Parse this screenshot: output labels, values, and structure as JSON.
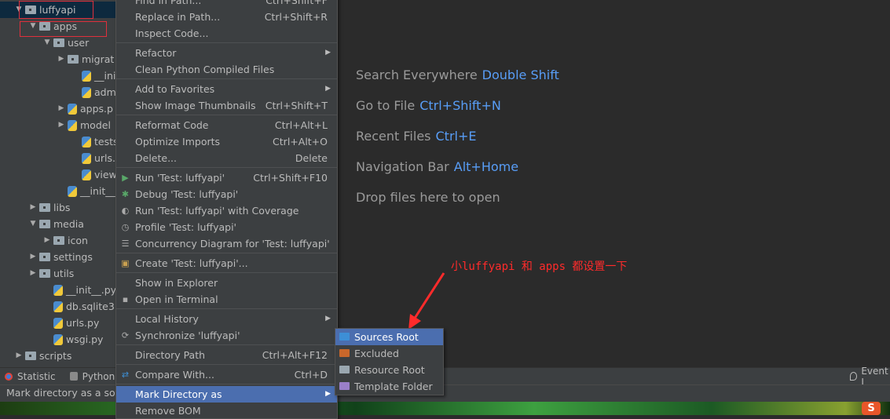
{
  "project_tree": [
    {
      "label": "luffyapi",
      "type": "folder",
      "indent": 0,
      "arrow": "down",
      "selected": true
    },
    {
      "label": "apps",
      "type": "folder",
      "indent": 1,
      "arrow": "down"
    },
    {
      "label": "user",
      "type": "folder",
      "indent": 2,
      "arrow": "down"
    },
    {
      "label": "migrat",
      "type": "folder",
      "indent": 3,
      "arrow": "right"
    },
    {
      "label": "__init__",
      "type": "py",
      "indent": 4
    },
    {
      "label": "admin",
      "type": "py",
      "indent": 4
    },
    {
      "label": "apps.p",
      "type": "py",
      "indent": 3,
      "arrow": "right"
    },
    {
      "label": "model",
      "type": "py",
      "indent": 3,
      "arrow": "right"
    },
    {
      "label": "tests.p",
      "type": "py",
      "indent": 4
    },
    {
      "label": "urls.py",
      "type": "py",
      "indent": 4
    },
    {
      "label": "views.p",
      "type": "py",
      "indent": 4
    },
    {
      "label": "__init__.py",
      "type": "py",
      "indent": 3
    },
    {
      "label": "libs",
      "type": "folder",
      "indent": 1,
      "arrow": "right"
    },
    {
      "label": "media",
      "type": "folder",
      "indent": 1,
      "arrow": "down"
    },
    {
      "label": "icon",
      "type": "folder",
      "indent": 2,
      "arrow": "right"
    },
    {
      "label": "settings",
      "type": "folder",
      "indent": 1,
      "arrow": "right"
    },
    {
      "label": "utils",
      "type": "folder",
      "indent": 1,
      "arrow": "right"
    },
    {
      "label": "__init__.py",
      "type": "py",
      "indent": 2
    },
    {
      "label": "db.sqlite3",
      "type": "py",
      "indent": 2
    },
    {
      "label": "urls.py",
      "type": "py",
      "indent": 2
    },
    {
      "label": "wsgi.py",
      "type": "py",
      "indent": 2
    },
    {
      "label": "scripts",
      "type": "folder",
      "indent": 0,
      "arrow": "right"
    }
  ],
  "context_menu": [
    {
      "label": "Find in Path...",
      "shortcut": "Ctrl+Shift+F"
    },
    {
      "label": "Replace in Path...",
      "shortcut": "Ctrl+Shift+R"
    },
    {
      "label": "Inspect Code..."
    },
    {
      "sep": true
    },
    {
      "label": "Refactor",
      "submenu": true
    },
    {
      "label": "Clean Python Compiled Files"
    },
    {
      "sep": true
    },
    {
      "label": "Add to Favorites",
      "submenu": true
    },
    {
      "label": "Show Image Thumbnails",
      "shortcut": "Ctrl+Shift+T"
    },
    {
      "sep": true
    },
    {
      "label": "Reformat Code",
      "shortcut": "Ctrl+Alt+L"
    },
    {
      "label": "Optimize Imports",
      "shortcut": "Ctrl+Alt+O"
    },
    {
      "label": "Delete...",
      "shortcut": "Delete"
    },
    {
      "sep": true
    },
    {
      "label": "Run 'Test: luffyapi'",
      "shortcut": "Ctrl+Shift+F10",
      "icon": "run-icon"
    },
    {
      "label": "Debug 'Test: luffyapi'",
      "icon": "debug-icon"
    },
    {
      "label": "Run 'Test: luffyapi' with Coverage",
      "icon": "coverage-icon"
    },
    {
      "label": "Profile 'Test: luffyapi'",
      "icon": "profile-icon"
    },
    {
      "label": "Concurrency Diagram for 'Test: luffyapi'",
      "icon": "concurrency-icon"
    },
    {
      "sep": true
    },
    {
      "label": "Create 'Test: luffyapi'...",
      "icon": "create-config-icon"
    },
    {
      "sep": true
    },
    {
      "label": "Show in Explorer"
    },
    {
      "label": "Open in Terminal",
      "icon": "terminal-icon"
    },
    {
      "sep": true
    },
    {
      "label": "Local History",
      "submenu": true
    },
    {
      "label": "Synchronize 'luffyapi'",
      "icon": "sync-icon"
    },
    {
      "sep": true
    },
    {
      "label": "Directory Path",
      "shortcut": "Ctrl+Alt+F12"
    },
    {
      "sep": true
    },
    {
      "label": "Compare With...",
      "shortcut": "Ctrl+D",
      "icon": "compare-icon"
    },
    {
      "sep": true
    },
    {
      "label": "Mark Directory as",
      "submenu": true,
      "highlighted": true
    },
    {
      "label": "Remove BOM"
    }
  ],
  "submenu": [
    {
      "label": "Sources Root",
      "color": "#3d8fd6",
      "highlighted": true
    },
    {
      "label": "Excluded",
      "color": "#c8672b"
    },
    {
      "label": "Resource Root",
      "color": "#9aa7b0"
    },
    {
      "label": "Template Folder",
      "color": "#9a7fc9"
    }
  ],
  "editor_hints": [
    {
      "text": "Search Everywhere",
      "key": "Double Shift"
    },
    {
      "text": "Go to File",
      "key": "Ctrl+Shift+N"
    },
    {
      "text": "Recent Files",
      "key": "Ctrl+E"
    },
    {
      "text": "Navigation Bar",
      "key": "Alt+Home"
    },
    {
      "text": "Drop files here to open",
      "key": ""
    }
  ],
  "annotation": "小luffyapi 和 apps 都设置一下",
  "tool_windows": {
    "statistic": "Statistic",
    "python": "Python",
    "event_log": "Event L"
  },
  "status_text": "Mark directory as a sources root",
  "colors": {
    "accent": "#4b6eaf",
    "annotation": "#ff2b2b",
    "shortcut": "#589df6"
  }
}
